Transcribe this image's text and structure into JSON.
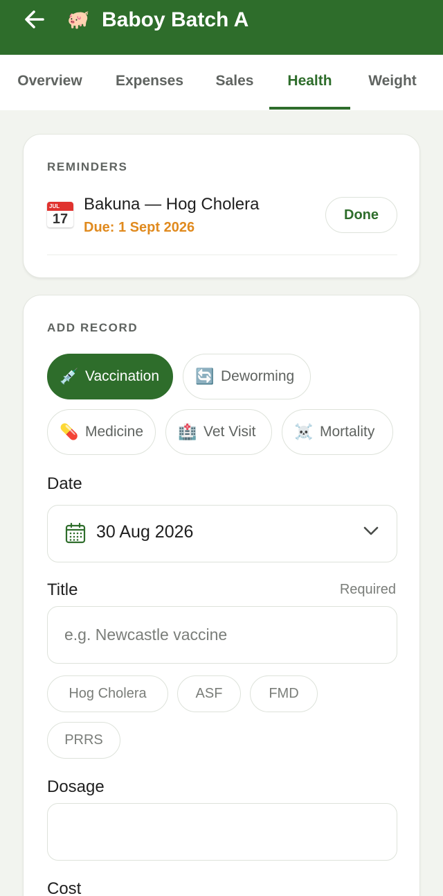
{
  "appbar": {
    "title": "Baboy Batch A",
    "back_icon": "arrow-left-icon",
    "pig_icon": "🐖"
  },
  "tabs": [
    {
      "label": "Overview",
      "active": false
    },
    {
      "label": "Expenses",
      "active": false
    },
    {
      "label": "Sales",
      "active": false
    },
    {
      "label": "Health",
      "active": true
    },
    {
      "label": "Weight",
      "active": false
    }
  ],
  "reminders": {
    "section_label": "REMINDERS",
    "items": [
      {
        "calendar_month": "JUL",
        "calendar_day": "17",
        "title": "Bakuna — Hog Cholera",
        "due": "Due: 1 Sept 2026",
        "done_label": "Done"
      }
    ]
  },
  "add_record": {
    "section_label": "ADD RECORD",
    "types": [
      {
        "icon": "💉",
        "label": "Vaccination",
        "selected": true
      },
      {
        "icon": "🔄",
        "label": "Deworming",
        "selected": false
      },
      {
        "icon": "💊",
        "label": "Medicine",
        "selected": false
      },
      {
        "icon": "🏥",
        "label": "Vet Visit",
        "selected": false
      },
      {
        "icon": "☠️",
        "label": "Mortality",
        "selected": false
      }
    ],
    "date": {
      "label": "Date",
      "value": "30 Aug 2026"
    },
    "title": {
      "label": "Title",
      "required_label": "Required",
      "placeholder": "e.g. Newcastle vaccine",
      "suggestions": [
        "Hog Cholera",
        "ASF",
        "FMD",
        "PRRS"
      ]
    },
    "dosage": {
      "label": "Dosage",
      "value": ""
    },
    "cost": {
      "label": "Cost"
    }
  },
  "colors": {
    "primary": "#2e6d2b",
    "due": "#e08a1e",
    "background": "#f2f4ef"
  }
}
